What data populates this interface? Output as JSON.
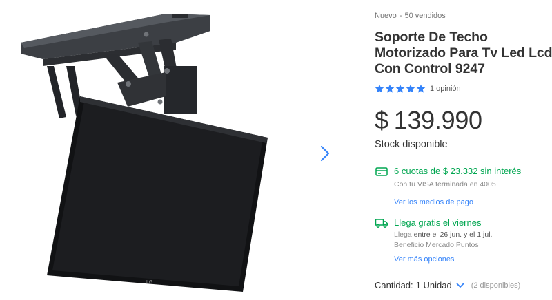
{
  "product": {
    "condition": "Nuevo",
    "separator": "-",
    "sold": "50 vendidos",
    "title": "Soporte De Techo Motorizado Para Tv Led Lcd Con Control 9247",
    "rating_stars": 5,
    "reviews": "1 opinión",
    "price_currency": "$",
    "price_amount": "139.990",
    "stock": "Stock disponible",
    "image_alt": "Soporte de techo motorizado con televisor"
  },
  "installments": {
    "headline": "6 cuotas de $ 23.332 sin interés",
    "detail": "Con tu VISA terminada en 4005",
    "link": "Ver los medios de pago",
    "icon": "card-icon"
  },
  "shipping": {
    "headline": "Llega gratis el viernes",
    "detail_prefix": "Llega",
    "detail_dates": "entre el 26 jun. y el 1 jul.",
    "points": "Beneficio Mercado Puntos",
    "link": "Ver más opciones",
    "icon": "truck-icon"
  },
  "quantity": {
    "label": "Cantidad:",
    "value": "1 Unidad",
    "available": "(2 disponibles)"
  },
  "colors": {
    "green": "#00a650",
    "blue": "#3483fa"
  }
}
